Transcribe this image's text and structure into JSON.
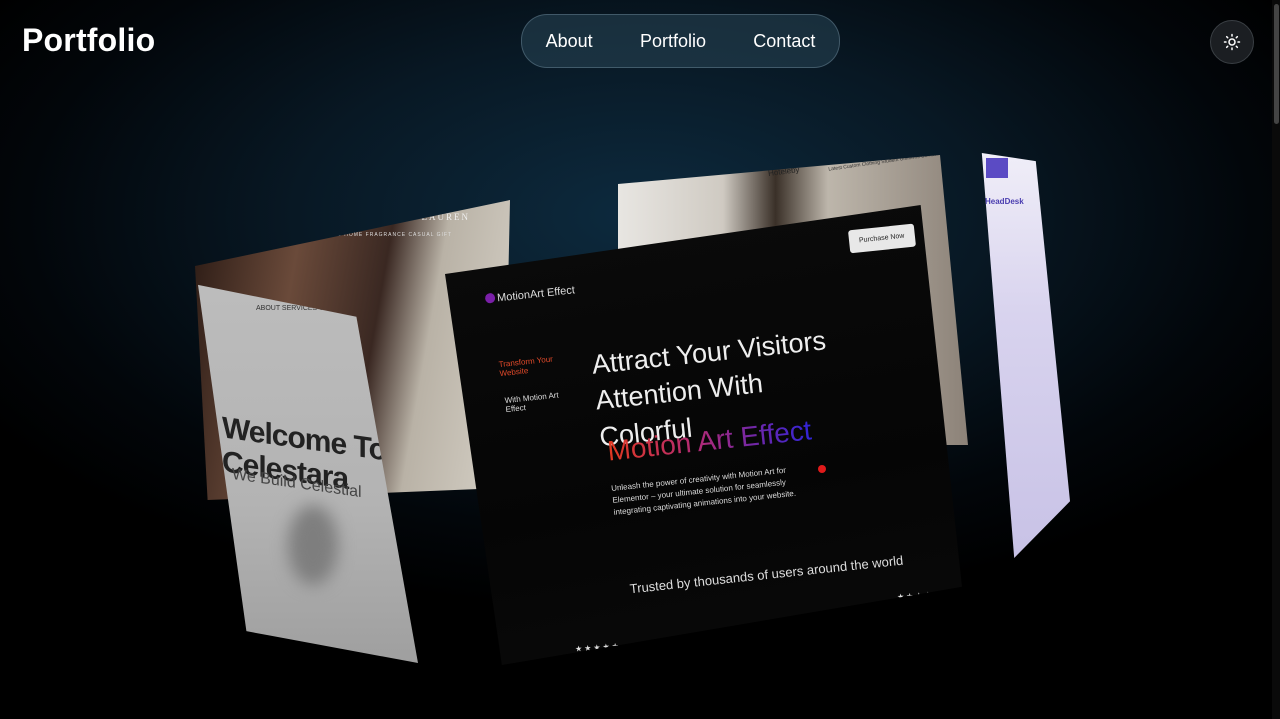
{
  "header": {
    "logo": "Portfolio",
    "nav": [
      "About",
      "Portfolio",
      "Contact"
    ],
    "theme_toggle_icon": "sun-icon"
  },
  "cards": {
    "ralph": {
      "brand": "RALPH LAUREN",
      "menu": "ALL   WOMEN   KIDS   HOME   FRAGRANCE   CASUAL   GIFT"
    },
    "celestara": {
      "top_links": "ABOUT   SERVICES   CONTACT",
      "heading": "Welcome To Celestara",
      "sub": "We Build Celestial"
    },
    "fashion": {
      "brand": "Hoteleby",
      "links": "Latest    Custom Clothing    Student Uniforms    Contact"
    },
    "purple": {
      "label": "HeadDesk"
    },
    "motion": {
      "logo": "MotionArt Effect",
      "side_accent": "Transform Your Website",
      "side_text": "With Motion Art Effect",
      "button": "Purchase Now",
      "headline": "Attract Your Visitors Attention With Colorful",
      "effect": "Motion Art Effect",
      "description": "Unleash the power of creativity with Motion Art for Elementor – your ultimate solution for seamlessly integrating captivating animations into your website.",
      "trusted": "Trusted by thousands of users around the world",
      "stars": "★★★★★"
    }
  }
}
